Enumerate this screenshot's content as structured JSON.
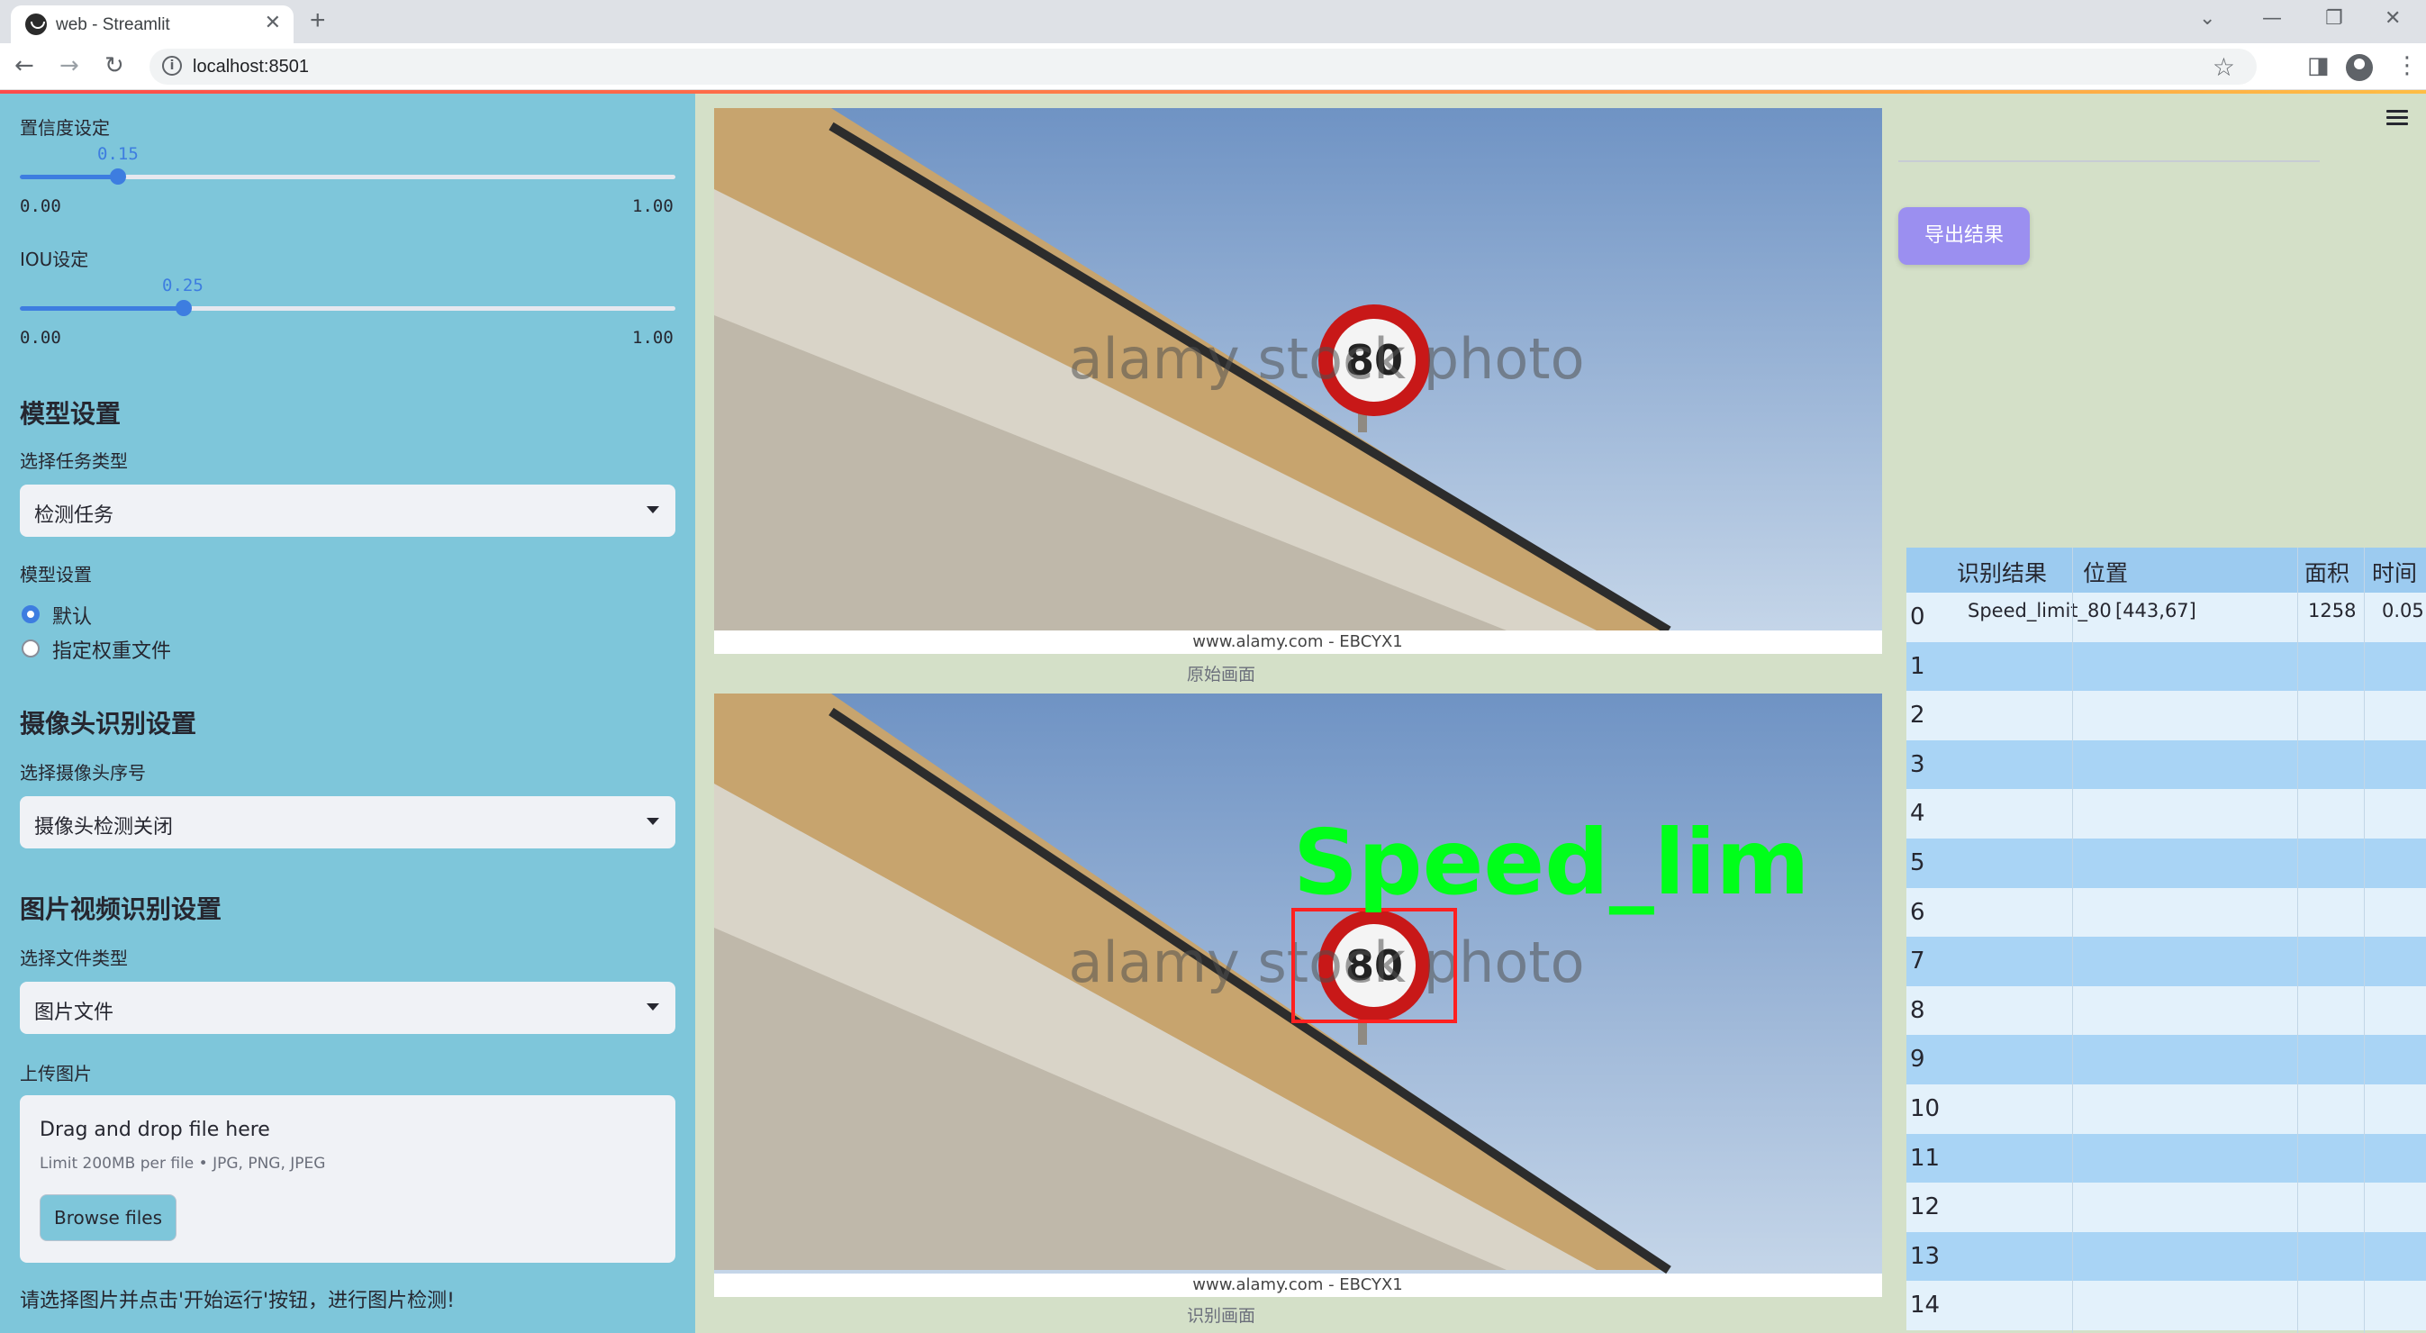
{
  "browser": {
    "tab_title": "web - Streamlit",
    "url": "localhost:8501"
  },
  "sidebar": {
    "confidence": {
      "label": "置信度设定",
      "value": "0.15",
      "min": "0.00",
      "max": "1.00",
      "fraction": 0.15
    },
    "iou": {
      "label": "IOU设定",
      "value": "0.25",
      "min": "0.00",
      "max": "1.00",
      "fraction": 0.25
    },
    "model_section": "模型设置",
    "task_label": "选择任务类型",
    "task_value": "检测任务",
    "model_label": "模型设置",
    "radio_default": "默认",
    "radio_custom": "指定权重文件",
    "camera_section": "摄像头识别设置",
    "camera_label": "选择摄像头序号",
    "camera_value": "摄像头检测关闭",
    "file_section": "图片视频识别设置",
    "file_type_label": "选择文件类型",
    "file_type_value": "图片文件",
    "upload_label": "上传图片",
    "drop_title": "Drag and drop file here",
    "drop_limit": "Limit 200MB per file • JPG, PNG, JPEG",
    "browse_label": "Browse files",
    "hint": "请选择图片并点击'开始运行'按钮，进行图片检测!"
  },
  "main": {
    "original_caption": "原始画面",
    "detected_caption": "识别画面",
    "sign_text": "80",
    "watermark": "alamy stock photo",
    "footer_watermark": "www.alamy.com - EBCYX1",
    "detection_label": "Speed_lim"
  },
  "right": {
    "export_label": "导出结果",
    "table": {
      "headers": [
        "识别结果",
        "位置",
        "面积",
        "时间"
      ],
      "rows": [
        {
          "idx": "0",
          "result": "Speed_limit_80",
          "pos": "[443,67]",
          "area": "1258",
          "time": "0.05"
        },
        {
          "idx": "1"
        },
        {
          "idx": "2"
        },
        {
          "idx": "3"
        },
        {
          "idx": "4"
        },
        {
          "idx": "5"
        },
        {
          "idx": "6"
        },
        {
          "idx": "7"
        },
        {
          "idx": "8"
        },
        {
          "idx": "9"
        },
        {
          "idx": "10"
        },
        {
          "idx": "11"
        },
        {
          "idx": "12"
        },
        {
          "idx": "13"
        },
        {
          "idx": "14"
        }
      ]
    }
  },
  "colors": {
    "sidebar_bg": "#7ec6da",
    "slider_accent": "#3d7de0",
    "export_button": "#9b8ff0",
    "detection_box": "#ff2020",
    "detection_text": "#00ff1a"
  }
}
